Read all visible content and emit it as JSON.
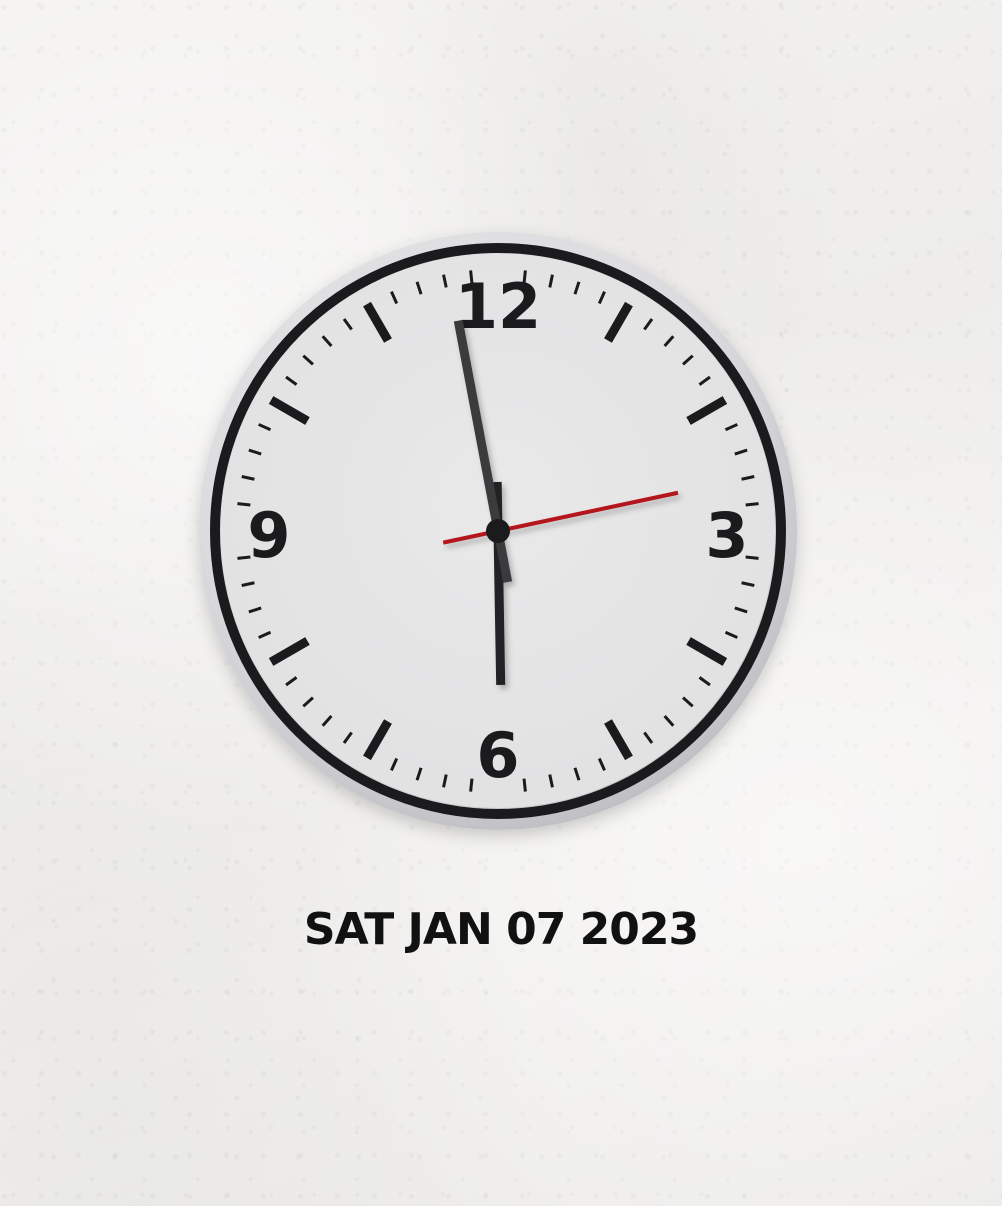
{
  "clock": {
    "numerals": {
      "twelve": "12",
      "three": "3",
      "six": "6",
      "nine": "9"
    },
    "time": {
      "hour": 5,
      "minute": 58,
      "second": 13
    },
    "colors": {
      "face": "#e6e6e7",
      "rim": "#1b1b1d",
      "bezel": "#c9c8cc",
      "hour_hand": "#222225",
      "minute_hand": "#3a3a3d",
      "second_hand": "#b3141a"
    }
  },
  "date": {
    "label": "SAT JAN 07 2023"
  }
}
